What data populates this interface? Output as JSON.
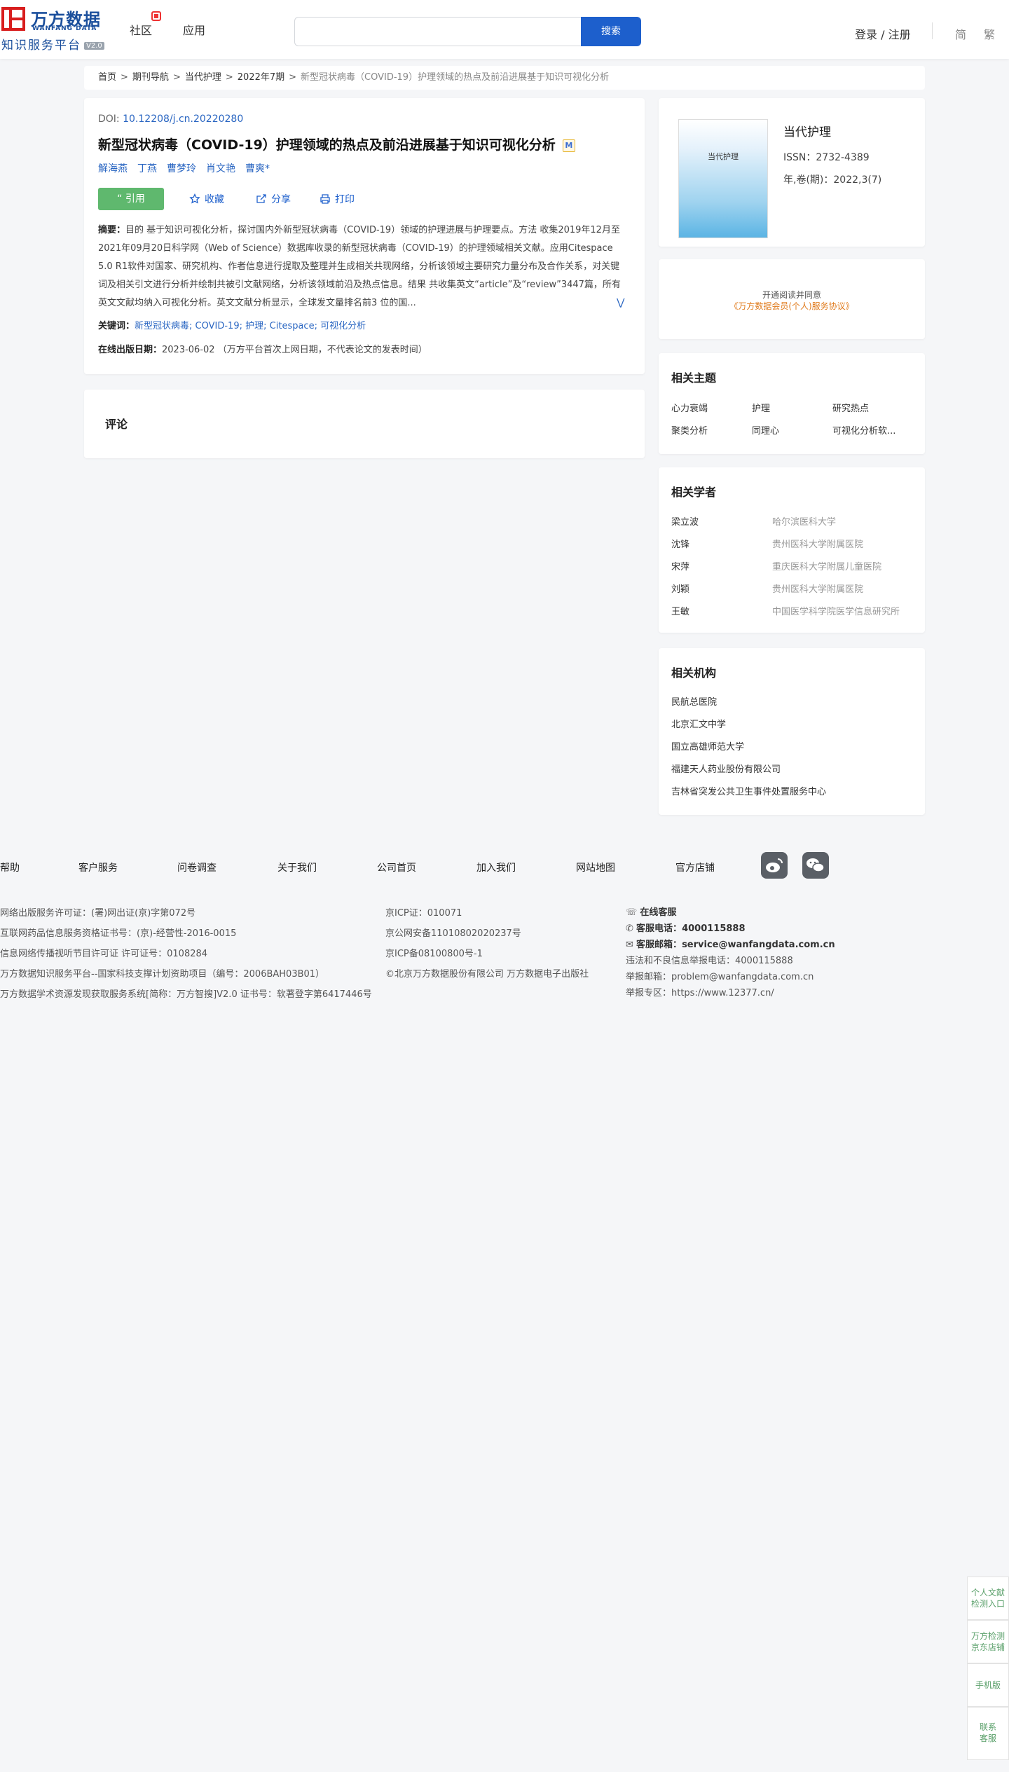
{
  "header": {
    "logo_cn": "万方数据",
    "logo_en": "WANFANG DATA",
    "logo_sub": "知识服务平台",
    "logo_version": "V2.0",
    "nav": [
      "社区",
      "应用"
    ],
    "search_placeholder": "",
    "search_button": "搜索",
    "login": "登录 / 注册",
    "lang_simplified": "简",
    "lang_traditional": "繁"
  },
  "breadcrumb": {
    "items": [
      "首页",
      "期刊导航",
      "当代护理",
      "2022年7期"
    ],
    "current": "新型冠状病毒（COVID-19）护理领域的热点及前沿进展基于知识可视化分析",
    "separator": ">"
  },
  "article": {
    "doi_label": "DOI:",
    "doi": "10.12208/j.cn.20220280",
    "title": "新型冠状病毒（COVID-19）护理领域的热点及前沿进展基于知识可视化分析",
    "title_badge": "M",
    "authors": [
      "解海燕",
      "丁燕",
      "曹梦玲",
      "肖文艳",
      "曹爽*"
    ],
    "actions": {
      "cite": "“ 引用",
      "favorite": "收藏",
      "share": "分享",
      "print": "打印"
    },
    "abstract_label": "摘要：",
    "abstract": "目的 基于知识可视化分析，探讨国内外新型冠状病毒（COVID-19）领域的护理进展与护理要点。方法 收集2019年12月至2021年09月20日科学网（Web of Science）数据库收录的新型冠状病毒（COVID-19）的护理领域相关文献。应用Citespace 5.0 R1软件对国家、研究机构、作者信息进行提取及整理并生成相关共现网络，分析该领域主要研究力量分布及合作关系，对关键词及相关引文进行分析并绘制共被引文献网络，分析该领域前沿及热点信息。结果 共收集英文“article”及“review”3447篇，所有英文文献均纳入可视化分析。英文文献分析显示，全球发文量排名前3 位的国...",
    "keywords_label": "关键词：",
    "keywords": [
      "新型冠状病毒",
      "COVID-19",
      "护理",
      "Citespace",
      "可视化分析"
    ],
    "pubdate_label": "在线出版日期：",
    "pubdate": "2023-06-02",
    "pubdate_note": "（万方平台首次上网日期，不代表论文的发表时间）"
  },
  "comments": {
    "title": "评论"
  },
  "journal": {
    "cover_title": "当代护理",
    "name": "当代护理",
    "issn": "ISSN：2732-4389",
    "volume": "年,卷(期)：2022,3(7)"
  },
  "open_access": {
    "line1": "开通阅读并同意",
    "line2": "《万方数据会员(个人)服务协议》"
  },
  "topics": {
    "title": "相关主题",
    "items": [
      "心力衰竭",
      "护理",
      "研究热点",
      "聚类分析",
      "同理心",
      "可视化分析软..."
    ]
  },
  "scholars": {
    "title": "相关学者",
    "items": [
      {
        "name": "梁立波",
        "org": "哈尔滨医科大学"
      },
      {
        "name": "沈锋",
        "org": "贵州医科大学附属医院"
      },
      {
        "name": "宋萍",
        "org": "重庆医科大学附属儿童医院"
      },
      {
        "name": "刘颖",
        "org": "贵州医科大学附属医院"
      },
      {
        "name": "王敏",
        "org": "中国医学科学院医学信息研究所"
      }
    ]
  },
  "institutions": {
    "title": "相关机构",
    "items": [
      "民航总医院",
      "北京汇文中学",
      "国立高雄师范大学",
      "福建天人药业股份有限公司",
      "吉林省突发公共卫生事件处置服务中心"
    ]
  },
  "footer": {
    "links": [
      "帮助",
      "客户服务",
      "问卷调查",
      "关于我们",
      "公司首页",
      "加入我们",
      "网站地图",
      "官方店铺"
    ],
    "social_icons": [
      "weibo-icon",
      "wechat-icon"
    ],
    "col1": [
      "网络出版服务许可证：(署)网出证(京)字第072号",
      "互联网药品信息服务资格证书号：(京)-经营性-2016-0015",
      "信息网络传播视听节目许可证 许可证号：0108284",
      "万方数据知识服务平台--国家科技支撑计划资助项目（编号：2006BAH03B01）",
      "万方数据学术资源发现获取服务系统[简称：万方智搜]V2.0 证书号：软著登字第6417446号"
    ],
    "col2": [
      "京ICP证：010071",
      "京公网安备11010802020237号",
      "京ICP备08100800号-1",
      "©北京万方数据股份有限公司 万方数据电子出版社"
    ],
    "col3": {
      "online": "在线客服",
      "phone_label": "客服电话：",
      "phone": "4000115888",
      "email_label": "客服邮箱：",
      "email": "service@wanfangdata.com.cn",
      "report_phone": "违法和不良信息举报电话：4000115888",
      "report_email": "举报邮箱：problem@wanfangdata.com.cn",
      "report_zone": "举报专区：https://www.12377.cn/"
    }
  },
  "sidebar": {
    "items": [
      [
        "个人文献",
        "检测入口"
      ],
      [
        "万方检测",
        "京东店铺"
      ],
      [
        "手机版"
      ],
      [
        "联系",
        "客服"
      ]
    ]
  }
}
